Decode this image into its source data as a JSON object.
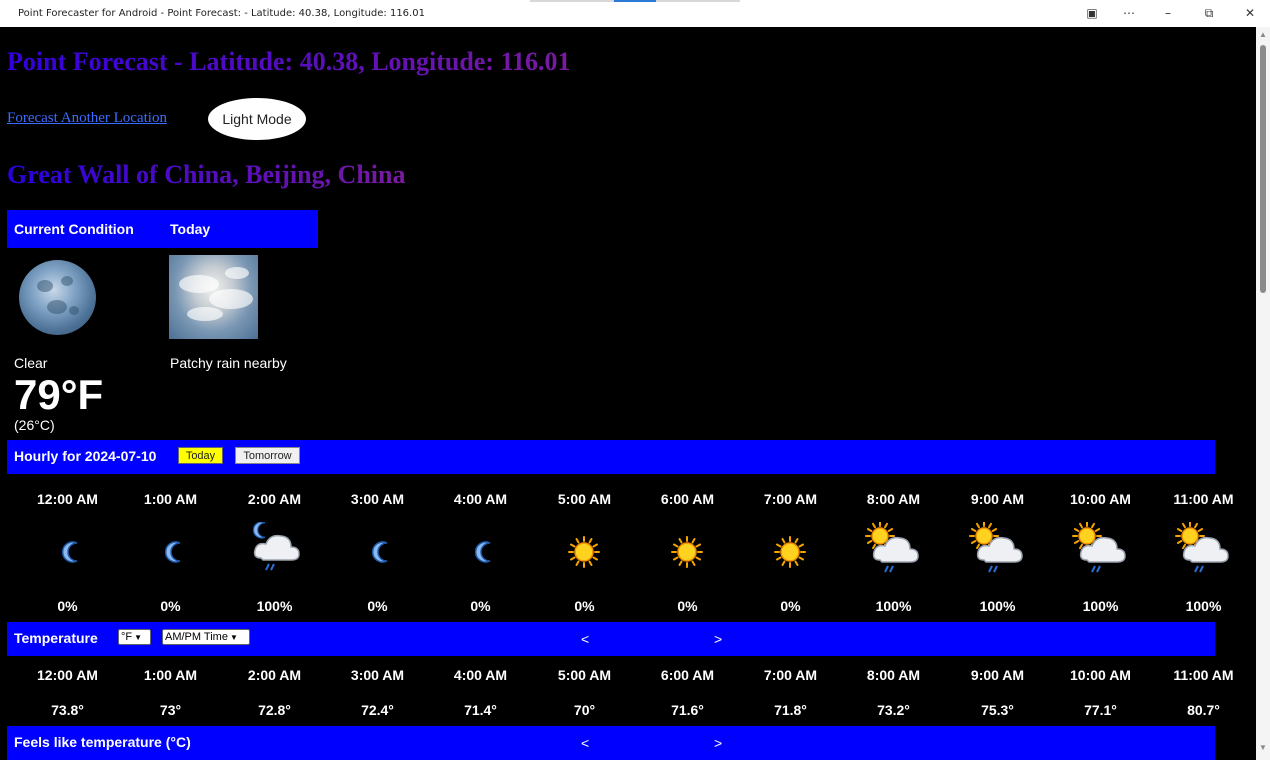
{
  "window": {
    "title": "Point Forecaster for Android - Point Forecast: - Latitude: 40.38, Longitude: 116.01",
    "controls": [
      "app-icon",
      "more-icon",
      "minimize-icon",
      "restore-icon",
      "close-icon"
    ]
  },
  "header": {
    "title": "Point Forecast - Latitude: 40.38, Longitude: 116.01",
    "another_link": "Forecast Another Location",
    "mode_button": "Light Mode",
    "location": "Great Wall of China, Beijing, China"
  },
  "conditions": {
    "current_label": "Current Condition",
    "today_label": "Today",
    "current_icon": "full-moon-photo",
    "today_icon": "clouds-photo",
    "current_text": "Clear",
    "today_text": "Patchy rain nearby",
    "temp_f": "79°F",
    "temp_c": "(26°C)"
  },
  "hourly": {
    "label": "Hourly for 2024-07-10",
    "today_btn": "Today",
    "tomorrow_btn": "Tomorrow",
    "hours": [
      "12:00 AM",
      "1:00 AM",
      "2:00 AM",
      "3:00 AM",
      "4:00 AM",
      "5:00 AM",
      "6:00 AM",
      "7:00 AM",
      "8:00 AM",
      "9:00 AM",
      "10:00 AM",
      "11:00 AM"
    ],
    "icons": [
      "moon-icon",
      "moon-icon",
      "moon-cloud-rain-icon",
      "moon-icon",
      "moon-icon",
      "sun-icon",
      "sun-icon",
      "sun-icon",
      "sun-cloud-rain-icon",
      "sun-cloud-rain-icon",
      "sun-cloud-rain-icon",
      "sun-cloud-rain-icon"
    ],
    "precip": [
      "0%",
      "0%",
      "100%",
      "0%",
      "0%",
      "0%",
      "0%",
      "0%",
      "100%",
      "100%",
      "100%",
      "100%"
    ]
  },
  "temperature": {
    "label": "Temperature",
    "unit_select": "°F",
    "time_select": "AM/PM Time",
    "prev": "<",
    "next": ">",
    "hours": [
      "12:00 AM",
      "1:00 AM",
      "2:00 AM",
      "3:00 AM",
      "4:00 AM",
      "5:00 AM",
      "6:00 AM",
      "7:00 AM",
      "8:00 AM",
      "9:00 AM",
      "10:00 AM",
      "11:00 AM"
    ],
    "values": [
      "73.8°",
      "73°",
      "72.8°",
      "72.4°",
      "71.4°",
      "70°",
      "71.6°",
      "71.8°",
      "73.2°",
      "75.3°",
      "77.1°",
      "80.7°"
    ]
  },
  "feels_like": {
    "label": "Feels like temperature (°C)",
    "prev": "<",
    "next": ">"
  },
  "colors": {
    "background": "#000000",
    "bar": "#0000ff",
    "today_button": "#ffff00",
    "link": "#3b6cff"
  }
}
